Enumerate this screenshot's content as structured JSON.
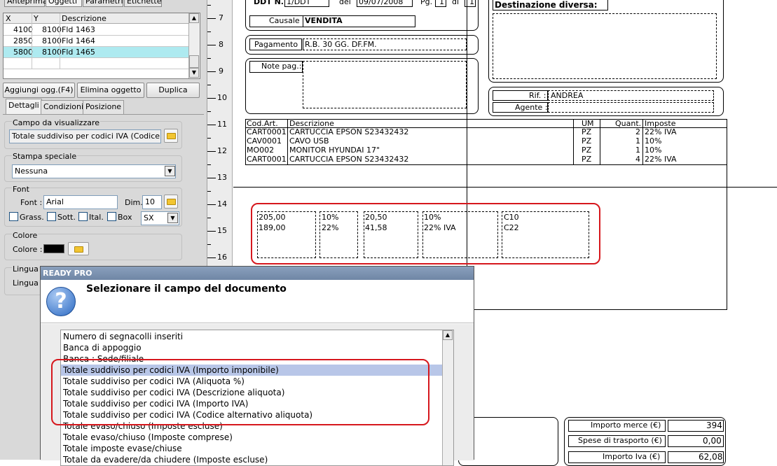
{
  "left_panel": {
    "top_tabs": [
      "Anteprima",
      "Oggetti",
      "Parametri",
      "Etichette"
    ],
    "grid": {
      "headers": [
        "X",
        "Y",
        "Descrizione"
      ],
      "rows": [
        {
          "x": "4100",
          "y": "8100",
          "desc": "Fld 1463"
        },
        {
          "x": "2850",
          "y": "8100",
          "desc": "Fld 1464"
        },
        {
          "x": "5800",
          "y": "8100",
          "desc": "Fld 1465"
        }
      ]
    },
    "buttons": {
      "add": "Aggiungi ogg.(F4)",
      "delete": "Elimina oggetto",
      "duplicate": "Duplica"
    },
    "sub_tabs": [
      "Dettagli",
      "Condizioni",
      "Posizione"
    ],
    "campo": {
      "label": "Campo da visualizzare",
      "value": "Totale suddiviso per codici IVA (Codice"
    },
    "stampa": {
      "label": "Stampa speciale",
      "value": "Nessuna"
    },
    "font": {
      "group_label": "Font",
      "font_label": "Font :",
      "font_value": "Arial",
      "dim_label": "Dim.",
      "dim_value": "10",
      "grass": "Grass.",
      "sott": "Sott.",
      "ital": "Ital.",
      "box": "Box",
      "align": "SX"
    },
    "colore": {
      "group_label": "Colore",
      "label": "Colore :",
      "color": "#000000"
    },
    "lingua": {
      "group_label": "Lingua",
      "label": "Lingua :"
    }
  },
  "ruler": [
    "7",
    "8",
    "9",
    "10",
    "11",
    "12",
    "13",
    "14",
    "15",
    "16"
  ],
  "document": {
    "ddt_label": "DDT N.",
    "ddt_value": "1/DDT",
    "del_label": "del",
    "date": "09/07/2008",
    "pg_label": "Pg.",
    "pg_value": "1",
    "di_label": "di",
    "pg_total": "1",
    "causale_label": "Causale",
    "causale_value": "VENDITA",
    "pagamento_label": "Pagamento",
    "pagamento_value": "R.B. 30 GG. DF.FM.",
    "note_label": "Note pag.:",
    "dest_label": "Destinazione diversa:",
    "rif_label": "Rif. :",
    "rif_value": "ANDREA",
    "agente_label": "Agente :",
    "table": {
      "headers": [
        "Cod.Art.",
        "Descrizione",
        "UM",
        "Quant.",
        "Imposte"
      ],
      "rows": [
        [
          "CART0001",
          "CARTUCCIA EPSON S23432432",
          "PZ",
          "2",
          "22% IVA"
        ],
        [
          "CAV0001",
          "CAVO USB",
          "PZ",
          "1",
          "10%"
        ],
        [
          "MO002",
          "MONITOR HYUNDAI 17\"",
          "PZ",
          "1",
          "10%"
        ],
        [
          "CART0001",
          "CARTUCCIA EPSON S23432432",
          "PZ",
          "4",
          "22% IVA"
        ]
      ]
    },
    "iva_boxes": {
      "imponibile": [
        "205,00",
        "189,00"
      ],
      "aliquota": [
        "10%",
        "22%"
      ],
      "importo": [
        "20,50",
        "41,58"
      ],
      "descrizione": [
        "10%",
        "22% IVA"
      ],
      "codice": [
        "C10",
        "C22"
      ]
    },
    "totals": [
      {
        "label": "Importo merce (€)",
        "value": "394"
      },
      {
        "label": "Spese di trasporto (€)",
        "value": "0,00"
      },
      {
        "label": "Importo Iva (€)",
        "value": "62,08"
      }
    ]
  },
  "dialog": {
    "titlebar": "READY PRO",
    "heading": "Selezionare il campo del documento",
    "items": [
      "Numero di segnacolli inseriti",
      "Banca di appoggio",
      "Banca : Sede/filiale",
      "Totale suddiviso per codici IVA (Importo imponibile)",
      "Totale suddiviso per codici IVA (Aliquota %)",
      "Totale suddiviso per codici IVA (Descrizione aliquota)",
      "Totale suddiviso per codici IVA (Importo IVA)",
      "Totale suddiviso per codici IVA (Codice alternativo aliquota)",
      "Totale evaso/chiuso (Imposte escluse)",
      "Totale evaso/chiuso (Imposte comprese)",
      "Totale imposte evase/chiuse",
      "Totale da evadere/da chiudere (Imposte escluse)"
    ],
    "selected_index": 3
  }
}
